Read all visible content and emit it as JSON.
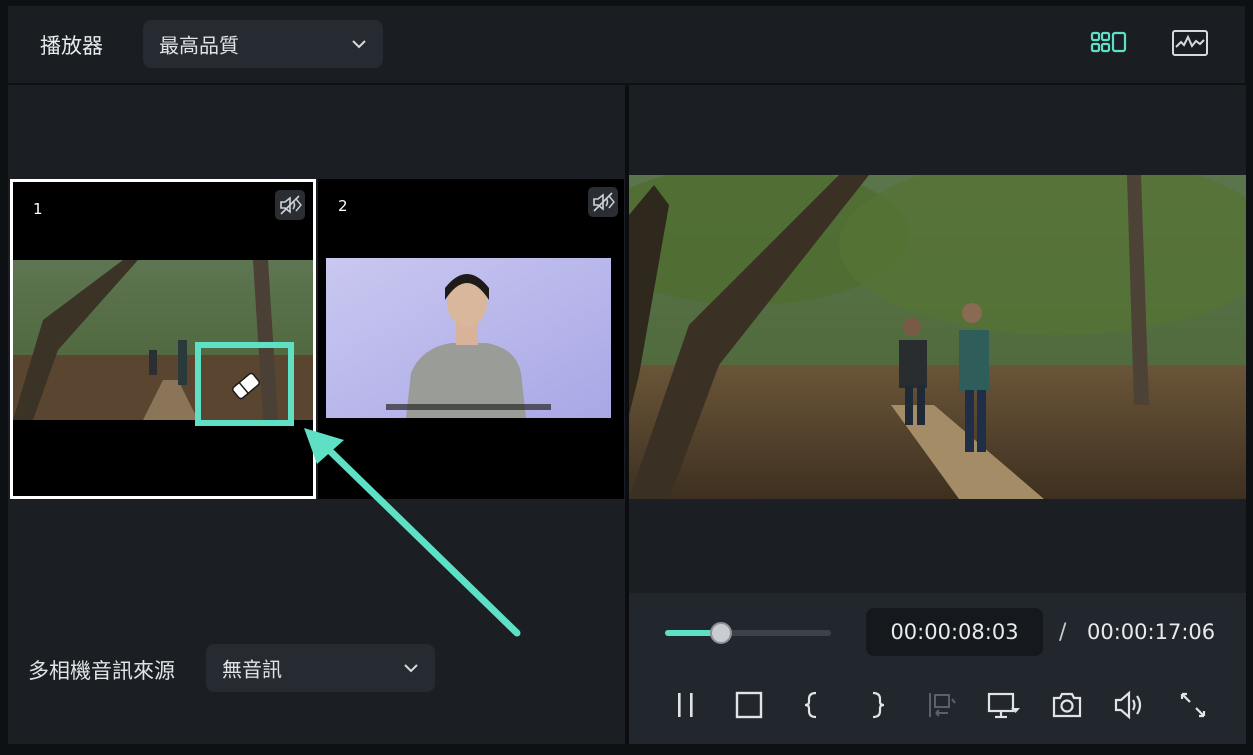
{
  "header": {
    "title": "播放器",
    "quality": {
      "selected": "最高品質"
    }
  },
  "multicam": {
    "angles": [
      {
        "number": "1",
        "selected": true
      },
      {
        "number": "2",
        "selected": false
      }
    ],
    "audio_source": {
      "label": "多相機音訊來源",
      "selected": "無音訊"
    }
  },
  "playback": {
    "current_time": "00:00:08:03",
    "separator": "/",
    "duration": "00:00:17:06",
    "progress": 0.34
  },
  "colors": {
    "accent": "#5ee0c4",
    "annotation": "#5ee0c4",
    "selected_border": "#ffffff"
  },
  "icons": [
    "chevron-down-icon",
    "multicam-grid-icon",
    "waveform-icon",
    "speaker-mute-icon",
    "paint-brush-icon",
    "pause-icon",
    "stop-icon",
    "mark-in-icon",
    "mark-out-icon",
    "insert-clip-icon",
    "monitor-display-icon",
    "camera-snapshot-icon",
    "volume-icon",
    "fullscreen-icon"
  ]
}
